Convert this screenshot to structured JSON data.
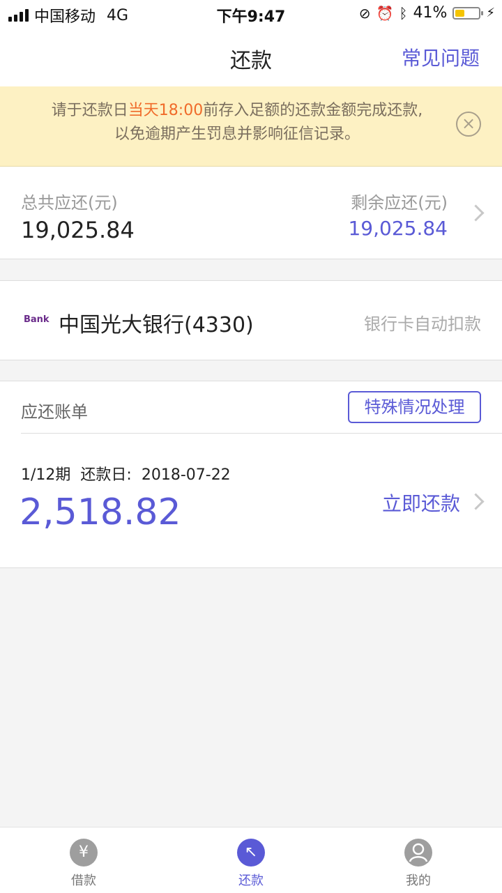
{
  "status_bar": {
    "carrier": "中国移动",
    "network": "4G",
    "time": "下午9:47",
    "battery": "41%",
    "battery_level": 0.41
  },
  "navbar": {
    "title": "还款",
    "faq": "常见问题"
  },
  "banner": {
    "line1_prefix": "请于还款日",
    "line1_highlight": "当天18:00",
    "line1_suffix": "前存入足额的还款金额完成还款,",
    "line2": "以免逾期产生罚息并影响征信记录。"
  },
  "totals": {
    "total_label": "总共应还(元)",
    "total_value": "19,025.84",
    "remaining_label": "剩余应还(元)",
    "remaining_value": "19,025.84"
  },
  "bank": {
    "logo_text": "Bank",
    "name": "中国光大银行(4330)",
    "auto_deduct": "银行卡自动扣款"
  },
  "bill": {
    "title": "应还账单",
    "special_button": "特殊情况处理",
    "period": "1/12期",
    "due_label": "还款日:",
    "due_date": "2018-07-22",
    "amount": "2,518.82",
    "pay_now": "立即还款"
  },
  "tabs": [
    {
      "label": "借款",
      "icon": "yuan-icon",
      "active": false
    },
    {
      "label": "还款",
      "icon": "repay-arrow-icon",
      "active": true
    },
    {
      "label": "我的",
      "icon": "user-icon",
      "active": false
    }
  ],
  "colors": {
    "accent": "#5a5ad6",
    "banner_bg": "#fdf1c3",
    "highlight": "#f06b2a"
  }
}
